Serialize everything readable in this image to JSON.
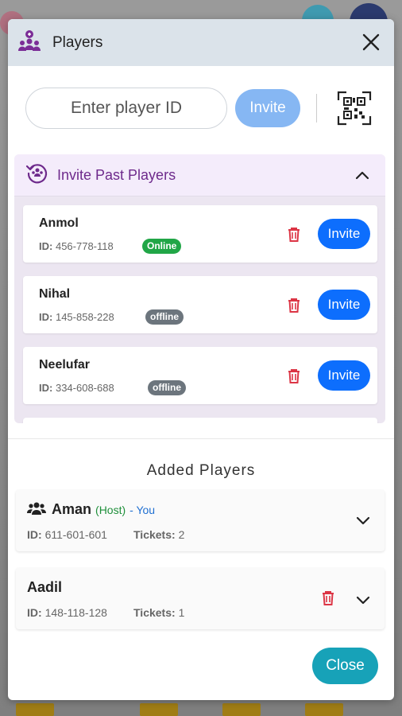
{
  "modal": {
    "title": "Players",
    "close_icon": "close-icon",
    "header_icon": "players-icon"
  },
  "invite": {
    "placeholder": "Enter player ID",
    "button_label": "Invite",
    "qr_icon": "qr-code-icon"
  },
  "past": {
    "title": "Invite Past Players",
    "icon": "history-players-icon",
    "players": [
      {
        "name": "Anmol",
        "id_label": "ID:",
        "id": "456-778-118",
        "status": "Online",
        "invite_label": "Invite"
      },
      {
        "name": "Nihal",
        "id_label": "ID:",
        "id": "145-858-228",
        "status": "offline",
        "invite_label": "Invite"
      },
      {
        "name": "Neelufar",
        "id_label": "ID:",
        "id": "334-608-688",
        "status": "offline",
        "invite_label": "Invite"
      }
    ]
  },
  "added": {
    "title": "Added Players",
    "players": [
      {
        "name": "Aman",
        "host_tag": "(Host)",
        "you_tag": "- You",
        "id_label": "ID:",
        "id": "611-601-601",
        "tickets_label": "Tickets:",
        "tickets": "2"
      },
      {
        "name": "Aadil",
        "id_label": "ID:",
        "id": "148-118-128",
        "tickets_label": "Tickets:",
        "tickets": "1"
      }
    ]
  },
  "footer": {
    "close_label": "Close"
  },
  "colors": {
    "accent_purple": "#6e2a8c",
    "invite_blue": "#0d6efd",
    "online_green": "#21a647",
    "offline_gray": "#6c757d",
    "close_teal": "#17a2b8",
    "trash_red": "#dc3545"
  }
}
